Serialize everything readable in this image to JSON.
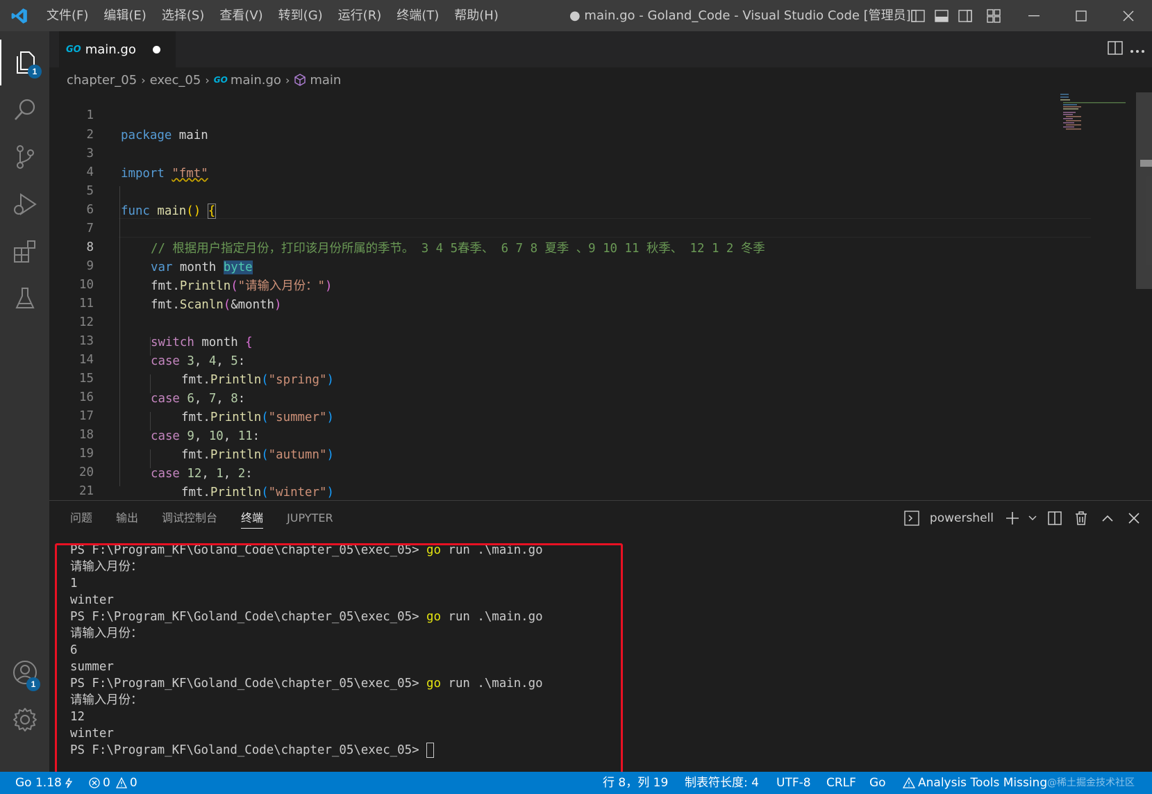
{
  "titlebar": {
    "menus": [
      "文件(F)",
      "编辑(E)",
      "选择(S)",
      "查看(V)",
      "转到(G)",
      "运行(R)",
      "终端(T)",
      "帮助(H)"
    ],
    "window_title": "● main.go - Goland_Code - Visual Studio Code [管理员]"
  },
  "activity": {
    "explorer_badge": "1",
    "accounts_badge": "1"
  },
  "tab": {
    "go_mark": "GO",
    "label": "main.go"
  },
  "breadcrumb": {
    "items": [
      "chapter_05",
      "exec_05",
      "main.go",
      "main"
    ]
  },
  "editor": {
    "line_numbers": [
      "1",
      "2",
      "3",
      "4",
      "5",
      "6",
      "7",
      "8",
      "9",
      "10",
      "11",
      "12",
      "13",
      "14",
      "15",
      "16",
      "17",
      "18",
      "19",
      "20",
      "21"
    ],
    "current_line": "8",
    "code": {
      "l1_kw": "package",
      "l1_name": "main",
      "l3_kw": "import",
      "l3_str": "\"fmt\"",
      "l5_kw": "func",
      "l5_fn": "main",
      "l5_paren": "()",
      "l5_brace": "{",
      "l7_comment": "// 根据用户指定月份，打印该月份所属的季节。 3 4 5春季、 6 7 8 夏季 、9 10 11 秋季、 12 1 2 冬季",
      "l8_kw": "var",
      "l8_name": "month",
      "l8_type": "byte",
      "l9_pkg": "fmt.",
      "l9_fn": "Println",
      "l9_str": "\"请输入月份：\"",
      "l10_pkg": "fmt.",
      "l10_fn": "Scanln",
      "l10_arg": "&month",
      "l12_kw": "switch",
      "l12_name": "month",
      "l12_brace": "{",
      "l13_kw": "case",
      "l13_vals": [
        "3",
        "4",
        "5"
      ],
      "l14_pkg": "fmt.",
      "l14_fn": "Println",
      "l14_str": "\"spring\"",
      "l15_kw": "case",
      "l15_vals": [
        "6",
        "7",
        "8"
      ],
      "l16_pkg": "fmt.",
      "l16_fn": "Println",
      "l16_str": "\"summer\"",
      "l17_kw": "case",
      "l17_vals": [
        "9",
        "10",
        "11"
      ],
      "l18_pkg": "fmt.",
      "l18_fn": "Println",
      "l18_str": "\"autumn\"",
      "l19_kw": "case",
      "l19_vals": [
        "12",
        "1",
        "2"
      ],
      "l20_pkg": "fmt.",
      "l20_fn": "Println",
      "l20_str": "\"winter\"",
      "l21_brace": "}"
    }
  },
  "panel": {
    "tabs": [
      "问题",
      "输出",
      "调试控制台",
      "终端",
      "JUPYTER"
    ],
    "active_tab": "终端",
    "shell": "powershell"
  },
  "terminal": {
    "prompt": "PS F:\\Program_KF\\Goland_Code\\chapter_05\\exec_05> ",
    "cmd_go": "go",
    "cmd_rest": " run .\\main.go",
    "input_prompt": "请输入月份：",
    "runs": [
      {
        "input": "1",
        "output": "winter"
      },
      {
        "input": "6",
        "output": "summer"
      },
      {
        "input": "12",
        "output": "winter"
      }
    ]
  },
  "statusbar": {
    "go_version": "Go 1.18",
    "errors": "0",
    "warnings": "0",
    "position": "行 8，列 19",
    "tab_size": "制表符长度: 4",
    "encoding": "UTF-8",
    "eol": "CRLF",
    "language": "Go",
    "analysis": "Analysis Tools Missing",
    "watermark": "@稀土掘金技术社区"
  },
  "colors": {
    "accent": "#007acc",
    "highlight_box": "#e81123",
    "keyword": "#569cd6",
    "control_keyword": "#c586c0",
    "function": "#dcdcaa",
    "string": "#ce9178",
    "number": "#b5cea8",
    "comment": "#6a9955"
  },
  "icons": [
    "vscode-logo-icon",
    "files-icon",
    "search-icon",
    "source-control-icon",
    "run-debug-icon",
    "extensions-icon",
    "testing-icon",
    "accounts-icon",
    "settings-gear-icon",
    "split-editor-icon",
    "more-actions-icon",
    "package-icon",
    "terminal-icon",
    "add-icon",
    "trash-icon",
    "close-icon"
  ]
}
